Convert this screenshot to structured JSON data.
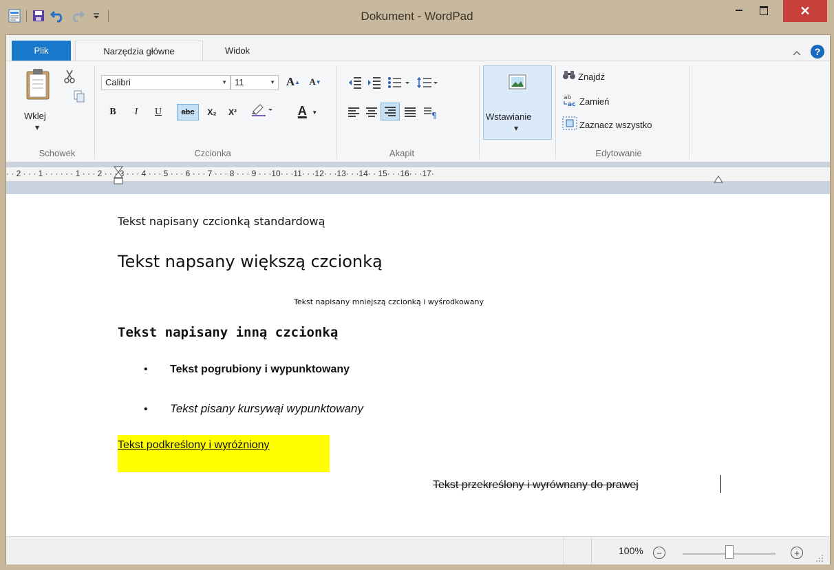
{
  "window": {
    "title": "Dokument - WordPad",
    "close_label": "✕"
  },
  "tabs": [
    {
      "label": "Plik",
      "active": false
    },
    {
      "label": "Narzędzia główne",
      "active": true
    },
    {
      "label": "Widok",
      "active": false
    }
  ],
  "ribbon": {
    "clipboard": {
      "group_label": "Schowek",
      "paste_label": "Wklej"
    },
    "font": {
      "group_label": "Czcionka",
      "font_name": "Calibri",
      "font_size": "11",
      "buttons": {
        "bold": "B",
        "italic": "I",
        "underline": "U",
        "strikethrough": "abc",
        "subscript": "X₂",
        "superscript": "X²",
        "grow": "A",
        "shrink": "A",
        "font_color": "A"
      }
    },
    "paragraph": {
      "group_label": "Akapit"
    },
    "insert": {
      "label": "Wstawianie"
    },
    "editing": {
      "group_label": "Edytowanie",
      "find": "Znajdź",
      "replace": "Zamień",
      "select_all": "Zaznacz wszystko"
    }
  },
  "ruler": {
    "text": "· · 2 · · · 1 · · ·  · · · 1 · · · 2 · · · 3 · · · 4 · · · 5 · · · 6 · · · 7 · · · 8 · · · 9 · · ·10· · ·11· · ·12· · ·13· · ·14· ·  15· · ·16· · ·17·"
  },
  "document": {
    "lines": [
      {
        "text": "Tekst napisany czcionką standardową"
      },
      {
        "text": "Tekst napsany większą czcionką"
      },
      {
        "text": "Tekst napisany mniejszą czcionką i wyśrodkowany"
      },
      {
        "text": "Tekst napisany inną czcionką"
      },
      {
        "text": "Tekst pogrubiony i wypunktowany"
      },
      {
        "text": "Tekst pisany kursywąi wypunktowany"
      },
      {
        "text": "Tekst podkreślony i wyróżniony"
      },
      {
        "text": "Tekst przekreślony i wyrównany do prawej"
      }
    ],
    "bullet": "•"
  },
  "status": {
    "zoom": "100%",
    "zoom_out": "−",
    "zoom_in": "+"
  },
  "colors": {
    "accent": "#1979ca",
    "highlight": "#ffff00",
    "close": "#c7403a"
  }
}
